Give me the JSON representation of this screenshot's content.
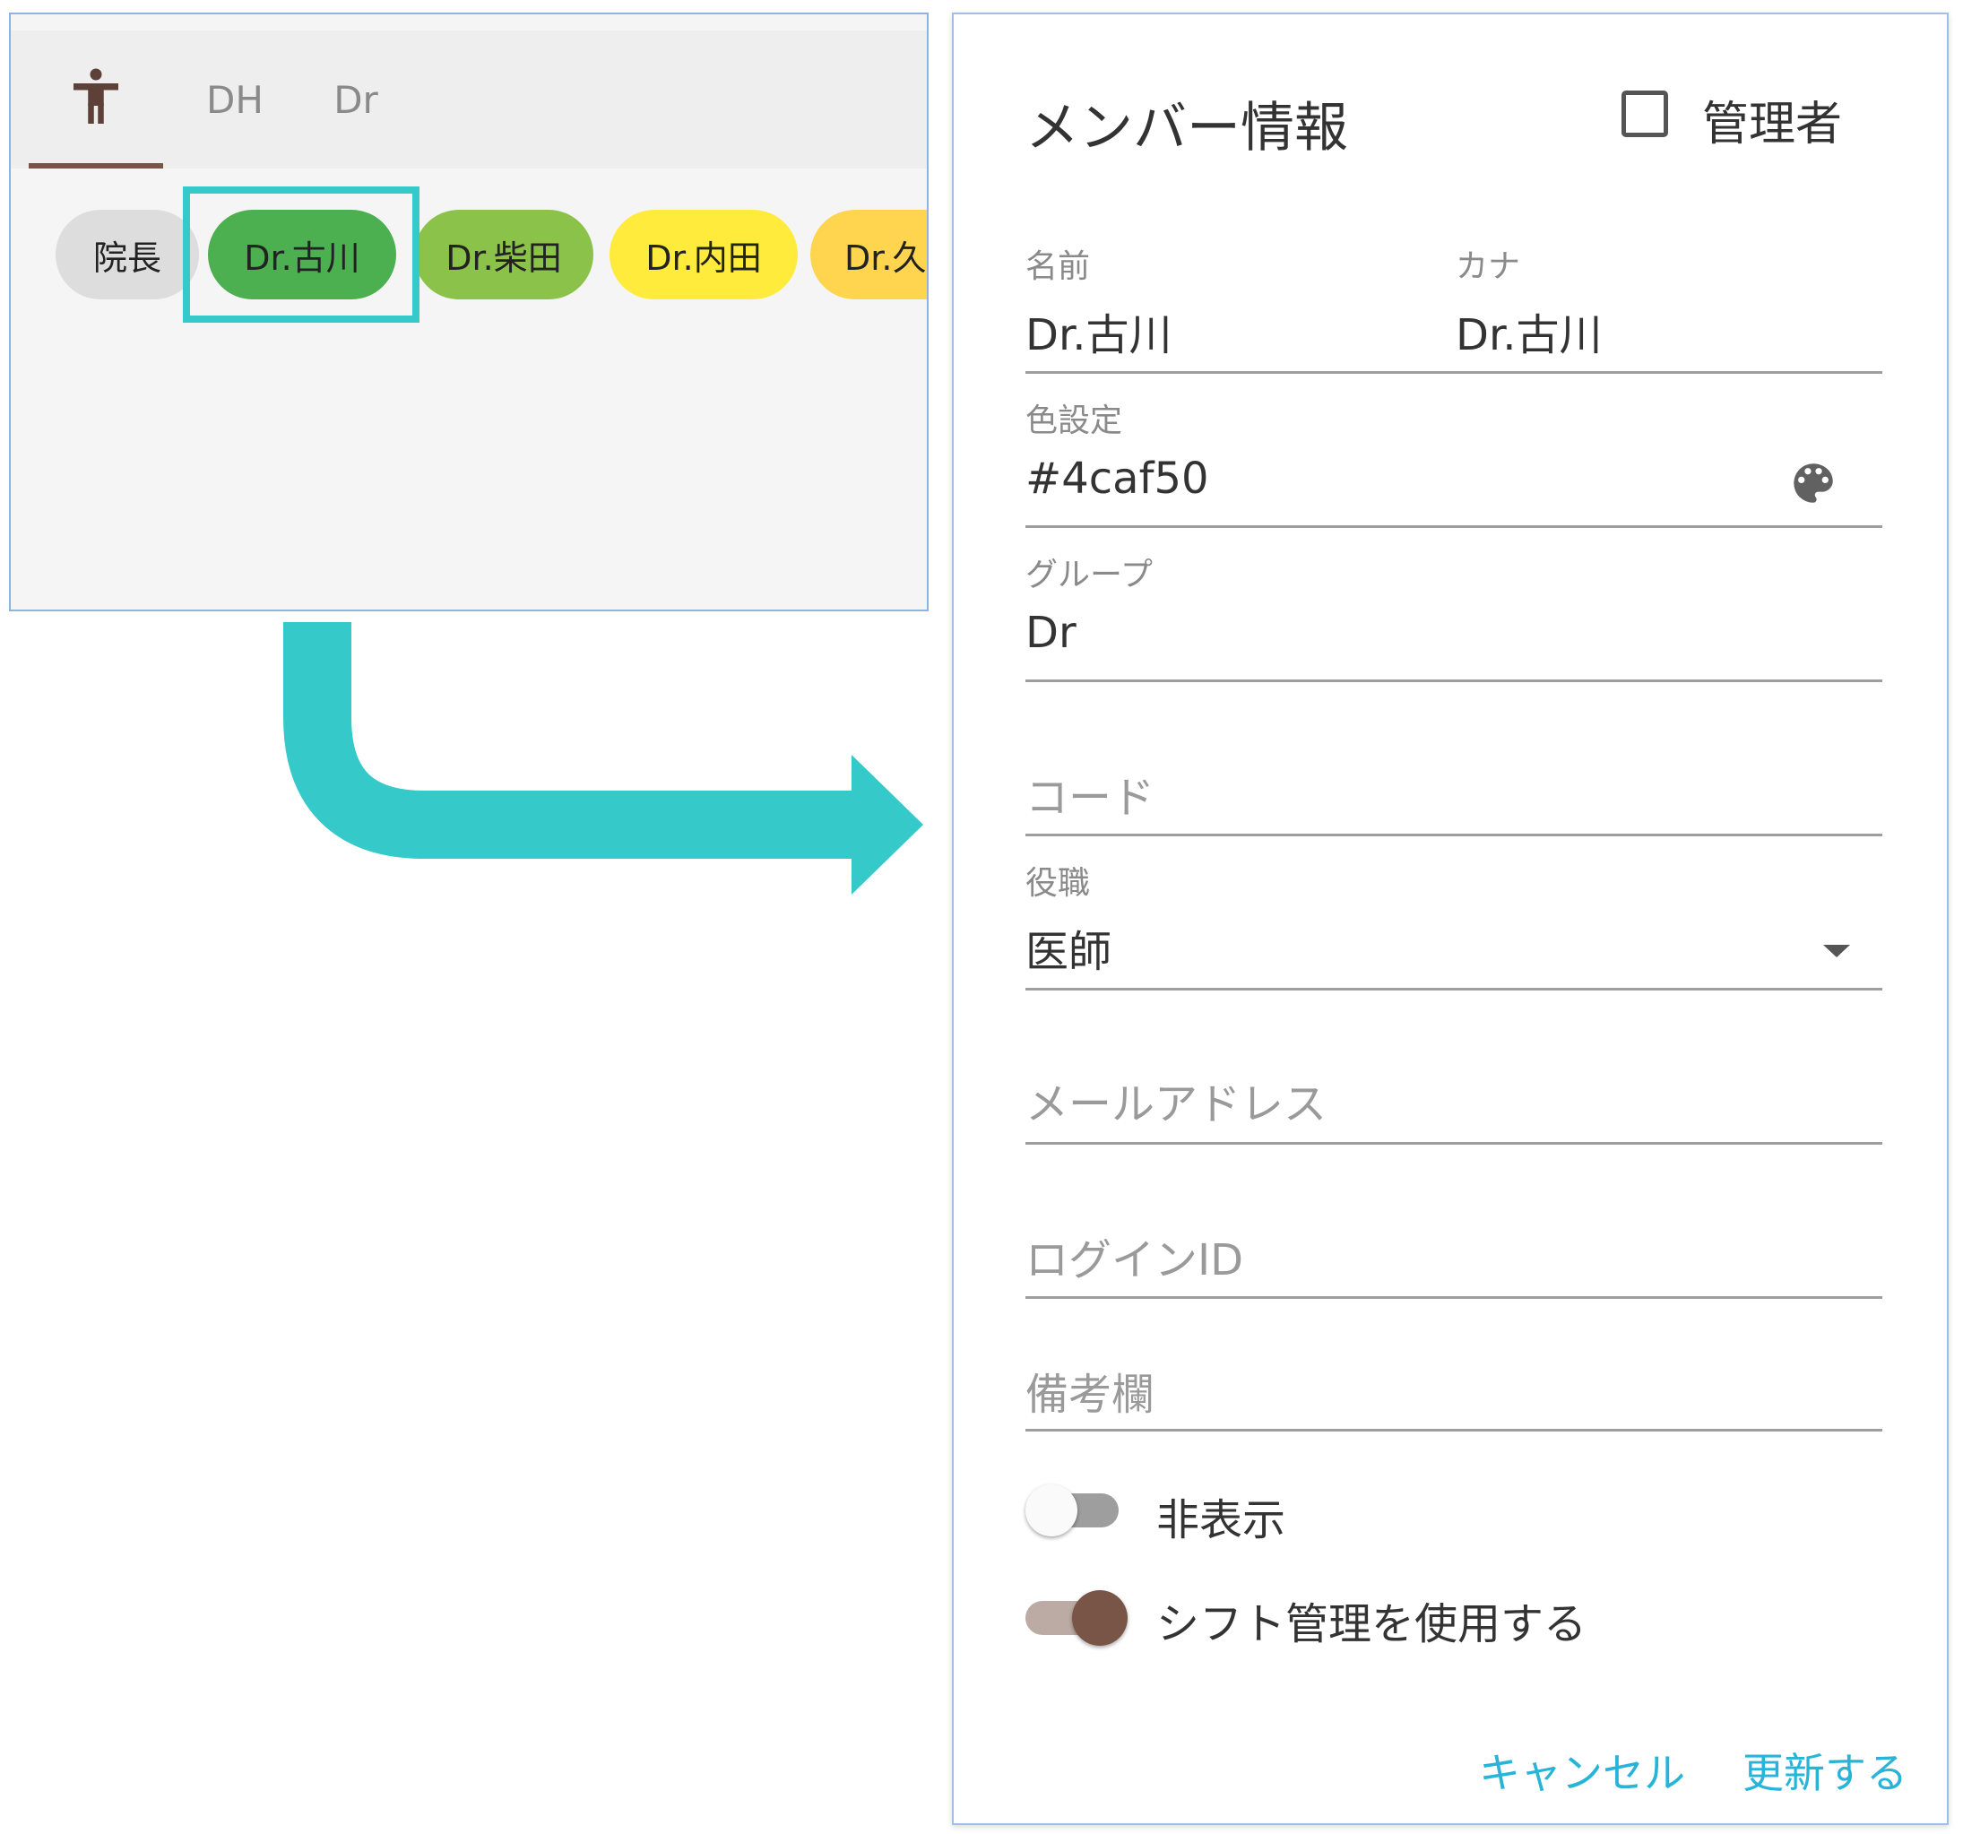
{
  "member_list": {
    "tabs": [
      {
        "icon": "person-icon",
        "label": ""
      },
      {
        "label": "DH"
      },
      {
        "label": "Dr"
      }
    ],
    "chips": [
      {
        "label": "院長",
        "color": "#dddddd"
      },
      {
        "label": "Dr.古川",
        "color": "#4caf50"
      },
      {
        "label": "Dr.柴田",
        "color": "#8bc34a"
      },
      {
        "label": "Dr.内田",
        "color": "#ffeb3b"
      },
      {
        "label": "Dr.久",
        "color": "#ffd54f"
      }
    ],
    "highlight_color": "#35c9c9"
  },
  "dialog": {
    "title": "メンバー情報",
    "admin_label": "管理者",
    "name_label": "名前",
    "name_value": "Dr.古川",
    "kana_label": "カナ",
    "kana_value": "Dr.古川",
    "color_label": "色設定",
    "color_value": "#4caf50",
    "group_label": "グループ",
    "group_value": "Dr",
    "code_placeholder": "コード",
    "position_label": "役職",
    "position_value": "医師",
    "email_placeholder": "メールアドレス",
    "login_placeholder": "ログインID",
    "notes_placeholder": "備考欄",
    "hide_label": "非表示",
    "shift_label": "シフト管理を使用する",
    "cancel_label": "キャンセル",
    "update_label": "更新する",
    "accent_color": "#28b4d8",
    "toggle_on_color": "#795548"
  }
}
